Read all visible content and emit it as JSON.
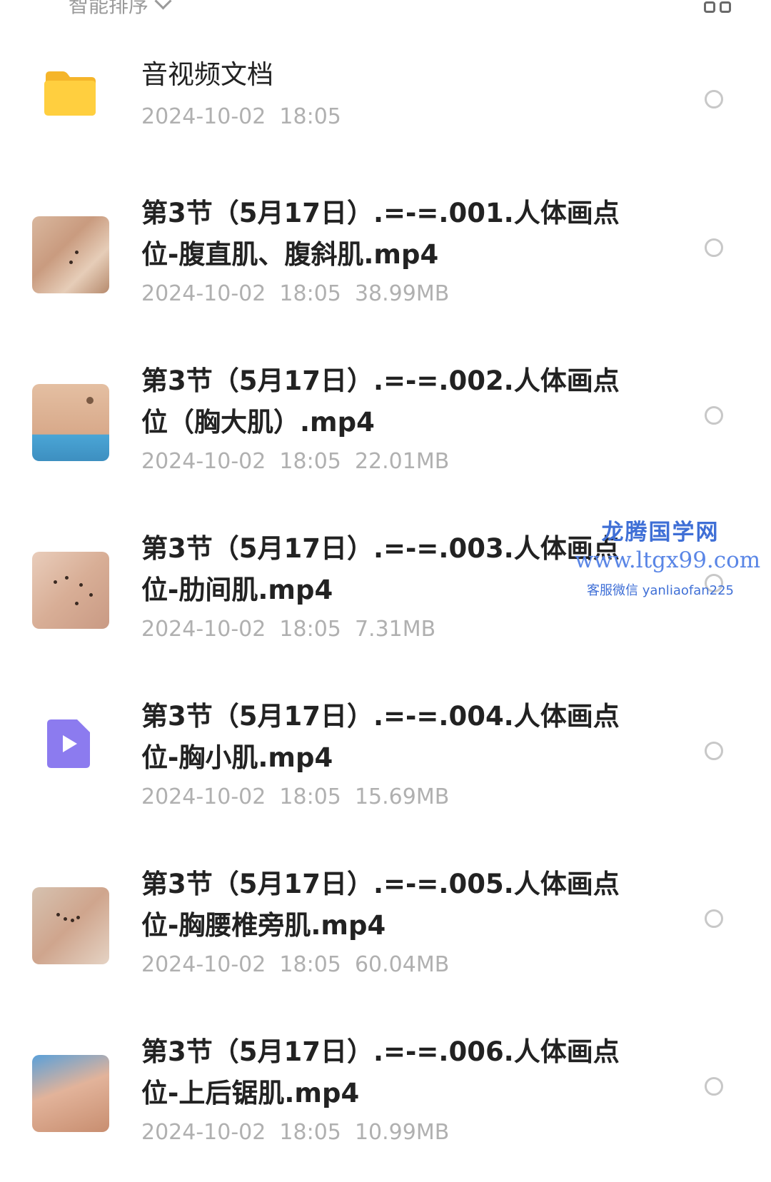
{
  "header": {
    "sort_label": "智能排序",
    "view_toggle_icon": "grid-view-icon"
  },
  "items": [
    {
      "type": "folder",
      "icon": "folder-icon",
      "name": "音视频文档",
      "meta": "2024-10-02  18:05"
    },
    {
      "type": "video",
      "icon": "video-thumbnail",
      "name": "第3节（5月17日）.=-=.001.人体画点位-腹直肌、腹斜肌.mp4",
      "meta": "2024-10-02  18:05  38.99MB"
    },
    {
      "type": "video",
      "icon": "video-thumbnail",
      "name": "第3节（5月17日）.=-=.002.人体画点位（胸大肌）.mp4",
      "meta": "2024-10-02  18:05  22.01MB"
    },
    {
      "type": "video",
      "icon": "video-thumbnail",
      "name": "第3节（5月17日）.=-=.003.人体画点位-肋间肌.mp4",
      "meta": "2024-10-02  18:05  7.31MB"
    },
    {
      "type": "video",
      "icon": "video-play-icon",
      "name": "第3节（5月17日）.=-=.004.人体画点位-胸小肌.mp4",
      "meta": "2024-10-02  18:05  15.69MB"
    },
    {
      "type": "video",
      "icon": "video-thumbnail",
      "name": "第3节（5月17日）.=-=.005.人体画点位-胸腰椎旁肌.mp4",
      "meta": "2024-10-02  18:05  60.04MB"
    },
    {
      "type": "video",
      "icon": "video-thumbnail",
      "name": "第3节（5月17日）.=-=.006.人体画点位-上后锯肌.mp4",
      "meta": "2024-10-02  18:05  10.99MB"
    }
  ],
  "watermark": {
    "line1": "龙腾国学网",
    "line2": "www.ltgx99.com",
    "line3": "客服微信 yanliaofan225"
  },
  "colors": {
    "folder": "#FFC83A",
    "video_icon": "#8C7BEF",
    "watermark": "#3F6FD6",
    "meta_text": "#B0B0B0"
  }
}
